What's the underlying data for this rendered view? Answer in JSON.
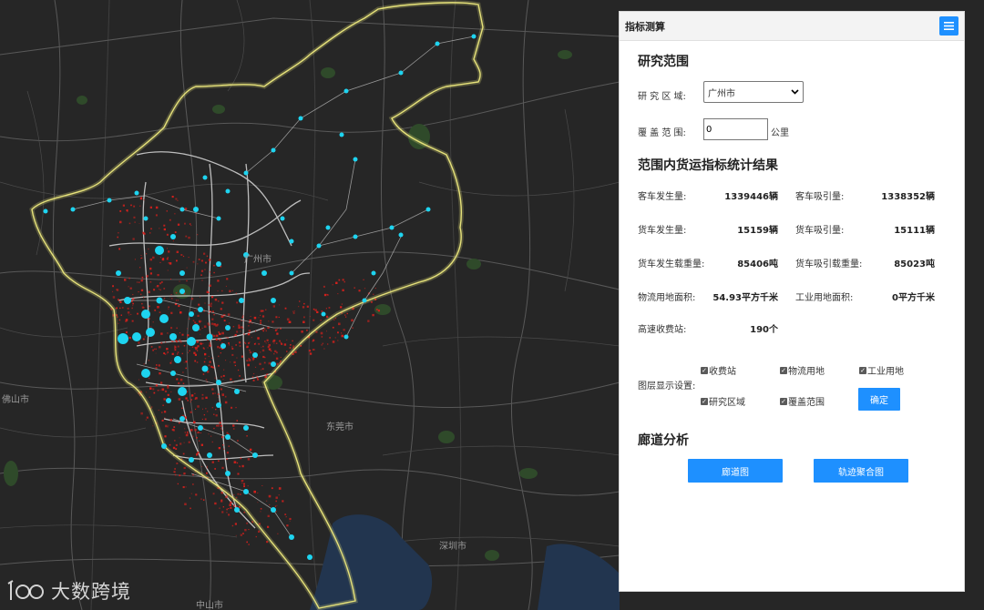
{
  "map": {
    "labels": [
      "广州市",
      "佛山市",
      "东莞市",
      "深圳市",
      "中山市"
    ]
  },
  "watermark": {
    "text": "大数跨境",
    "icon": "brand-logo-icon"
  },
  "panel": {
    "title": "指标测算",
    "menu_icon": "hamburger-menu-icon",
    "scope": {
      "heading": "研究范围",
      "region_label": "研 究 区 域:",
      "region_value": "广州市",
      "coverage_label": "覆 盖 范 围:",
      "coverage_value": "0",
      "coverage_unit": "公里"
    },
    "results": {
      "heading": "范围内货运指标统计结果",
      "stats": [
        {
          "label": "客车发生量:",
          "value": "1339446辆"
        },
        {
          "label": "客车吸引量:",
          "value": "1338352辆"
        },
        {
          "label": "货车发生量:",
          "value": "15159辆"
        },
        {
          "label": "货车吸引量:",
          "value": "15111辆"
        },
        {
          "label": "货车发生载重量:",
          "value": "85406吨"
        },
        {
          "label": "货车吸引载重量:",
          "value": "85023吨"
        },
        {
          "label": "物流用地面积:",
          "value": "54.93平方千米"
        },
        {
          "label": "工业用地面积:",
          "value": "0平方千米"
        },
        {
          "label": "高速收费站:",
          "value": "190个"
        }
      ]
    },
    "layers": {
      "label": "图层显示设置:",
      "options": [
        {
          "label": "收费站",
          "checked": true
        },
        {
          "label": "物流用地",
          "checked": true
        },
        {
          "label": "工业用地",
          "checked": true
        },
        {
          "label": "研究区域",
          "checked": true
        },
        {
          "label": "覆盖范围",
          "checked": true
        }
      ],
      "confirm_label": "确定"
    },
    "corridor": {
      "heading": "廊道分析",
      "corridor_button": "廊道图",
      "trajectory_button": "轨迹聚合图"
    }
  },
  "colors": {
    "background": "#262626",
    "boundary": "#e6e27a",
    "station": "#1ed4f0",
    "land": "#d8201c",
    "road": "#6a6a6a",
    "accent": "#1e90ff"
  }
}
